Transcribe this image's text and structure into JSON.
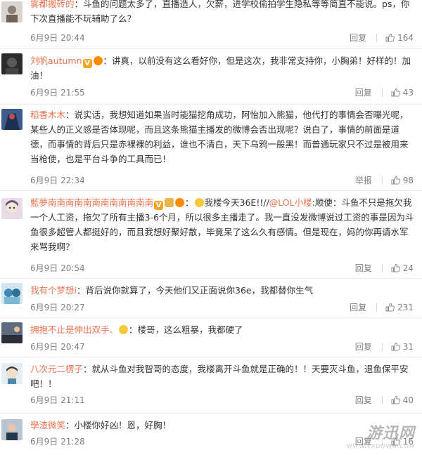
{
  "comments": [
    {
      "username": "雾都搬砖的",
      "text": "：斗鱼的问题太多了，直播造人，欠薪，进学校偷拍学生隐私等等简直不能说。ps，你下次直播能不玩辅助了么？",
      "time": "6月9日 20:44",
      "action": "回复",
      "likes": "164"
    },
    {
      "username": "刘帆autumn",
      "text": "：讲真，以前没有这么看好你，但是这次，我非常支持你，小胸弟！好样的！加油！",
      "time": "6月9日 21:55",
      "action": "回复",
      "likes": "43"
    },
    {
      "username": "稻香木木",
      "text": "：说实话，我想知道如果当时能猫挖角成功，阿怡加入熊猫，他代打的事情会否曝光呢，某些人的正义感是否体现呢，而且这条熊猫主播发的微博会否出现呢？说白了，事情的前面是道德，而事情的背后只是赤裸裸的利益，谁也不清白，天下乌鸦一般黑！而普通玩家只不过是被用来当枪使，也是平台斗争的工具而已！",
      "time": "6月9日 22:34",
      "action": "举报",
      "likes": "98"
    },
    {
      "username": "藍夢南南南南南南南南南南南南",
      "text_pre": "我楼今天36E!!//",
      "mention": "@LOL小楼",
      "text_post": ":顺便：斗鱼不只是拖欠我一个人工资，拖欠了所有主播3-6个月，所以很多主播走了。我一直没发微博说过工资的事是因为斗鱼很多超管人都挺好的，而且我想好聚好散，毕竟呆了这么久有感情。但是现在，妈的你再请水军来骂我啊？",
      "time": "6月9日 20:54",
      "action": "回复",
      "likes": "24"
    },
    {
      "username": "我有个梦想i",
      "text": "：背后说你就算了，今天他们又正面说你36e，我都替你生气",
      "time": "6月9日 20:27",
      "action": "回复",
      "likes": "231"
    },
    {
      "username": "拥抱不止是伸出双手、",
      "text": "：楼哥，这么粗暴，我都硬了",
      "time": "6月9日 20:47",
      "action": "回复",
      "likes": "31"
    },
    {
      "username": "八次元二楞子",
      "text": "：就从斗鱼对我智哥的态度，我楼离开斗鱼就是正确的！！天要灭斗鱼，退鱼保平安吧！！",
      "time": "6月9日 21:11",
      "action": "回复",
      "likes": "40"
    },
    {
      "username": "學渣微笑",
      "text": "：小楼你好凶！恩，好胸！",
      "time": "6月9日 21:28",
      "action": "回复",
      "likes": "16"
    }
  ],
  "watermark": {
    "main": "游迅网",
    "sub": "WWW.YXDOWN.COM"
  },
  "colors": {
    "username": "#eb7350",
    "meta": "#808080",
    "text": "#333333"
  }
}
